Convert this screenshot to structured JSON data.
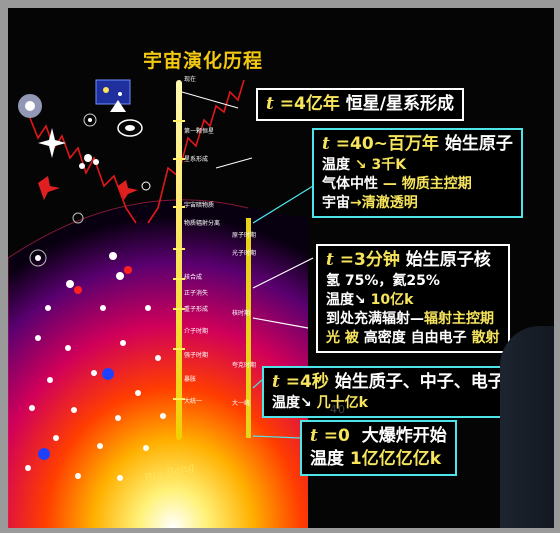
{
  "title": "宇宙演化历程",
  "big_bang_label": "Big Bang",
  "axis_labels": [
    {
      "text": "现在"
    },
    {
      "text": "第一颗恒星"
    },
    {
      "text": "星系形成"
    },
    {
      "text": "宇宙暗物质"
    },
    {
      "text": "物质辐射分离"
    },
    {
      "text": "光子时期"
    },
    {
      "text": "核合成"
    },
    {
      "text": "正子消失"
    },
    {
      "text": "重子形成"
    },
    {
      "text": "介子时期"
    },
    {
      "text": "强子时期"
    },
    {
      "text": "暴胀"
    },
    {
      "text": "大统一"
    }
  ],
  "right_labels": [
    {
      "text": "原子时期"
    },
    {
      "text": "光子时期"
    },
    {
      "text": "核时期"
    },
    {
      "text": "夸克时期"
    },
    {
      "text": "大一统"
    }
  ],
  "space_labels": [
    "太阳系",
    "地球",
    "银河系",
    "星云",
    "星系",
    "恒星"
  ],
  "boxes": {
    "b1": {
      "t": "t",
      "eq": "=4亿年",
      "text": "恒星/星系形成"
    },
    "b2": {
      "t": "t",
      "eq": "=40~百万年",
      "head": "始生原子",
      "l1a": "温度",
      "l1b": "↘",
      "l1c": "3千K",
      "l2a": "气体中性",
      "l2b": "—",
      "l2c": "物质主控期",
      "l3a": "宇宙",
      "l3b": "→清澈透明"
    },
    "b3": {
      "t": "t",
      "eq": "=3分钟",
      "head": "始生原子核",
      "l1": "氢 75%，氦25%",
      "l2a": "温度↘",
      "l2b": "10亿k",
      "l3a": "到处充满辐射—",
      "l3b": "辐射主控期",
      "l4a": "光 被",
      "l4b": "高密度",
      "l4c": "自由电子",
      "l4d": "散射"
    },
    "b4": {
      "t": "t",
      "eq": "=4秒",
      "head": "始生质子、中子、电子",
      "l1a": "温度↘",
      "l1b": "几十亿k"
    },
    "b5": {
      "t": "t",
      "eq": "=0",
      "head": "大爆炸开始",
      "l1a": "温度",
      "l1b": "1亿亿亿亿k"
    }
  },
  "watermark": "40"
}
